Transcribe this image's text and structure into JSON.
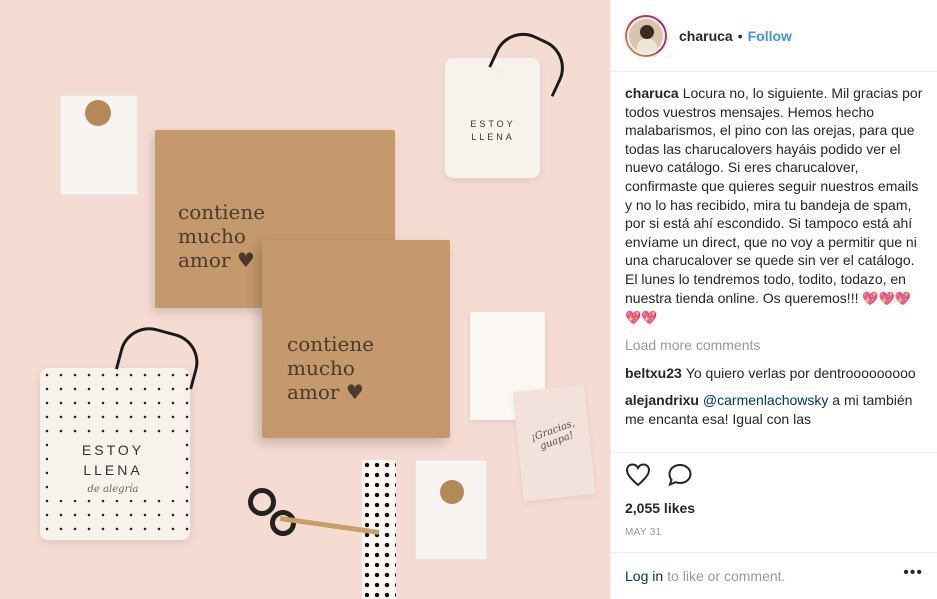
{
  "post": {
    "username": "charuca",
    "follow_label": "Follow",
    "separator": "•"
  },
  "photo": {
    "box1_text": [
      "contiene",
      "mucho",
      "amor"
    ],
    "box2_text": [
      "contiene",
      "mucho",
      "amor"
    ],
    "bag_small_text": [
      "ESTOY",
      "LLENA"
    ],
    "bag_large_text": [
      "ESTOY",
      "LLENA"
    ],
    "bag_large_script": "de alegría",
    "card_script": "¡Gracias, guapa!"
  },
  "caption": {
    "username": "charuca",
    "text": "Locura no, lo siguiente. Mil gracias por todos vuestros mensajes. Hemos hecho malabarismos, el pino con las orejas, para que todas las charucalovers hayáis podido ver el nuevo catálogo. Si eres charucalover, confirmaste que quieres seguir nuestros emails y no lo has recibido, mira tu bandeja de spam, por si está ahí escondido. Si tampoco está ahí envíame un direct, que no voy a permitir que ni una charucalover se quede sin ver el catálogo. El lunes lo tendremos todo, todito, todazo, en nuestra tienda online. Os queremos!!!",
    "emoji": "💖💖💖💖💖"
  },
  "load_more": "Load more comments",
  "comments": [
    {
      "username": "beltxu23",
      "text": "Yo quiero verlas por dentrooooooooo"
    },
    {
      "username": "alejandrixu",
      "mention": "@carmenlachowsky",
      "text": "a mi también me encanta esa! Igual con las"
    }
  ],
  "likes": "2,055 likes",
  "date": "MAY 31",
  "login": {
    "link": "Log in",
    "text": "to like or comment."
  },
  "icons": {
    "like": "heart-icon",
    "comment": "comment-icon",
    "more": "more-options-icon"
  },
  "colors": {
    "accent": "#3897f0",
    "link": "#003569",
    "muted": "#999999",
    "photo_bg": "#f5dcd3"
  }
}
